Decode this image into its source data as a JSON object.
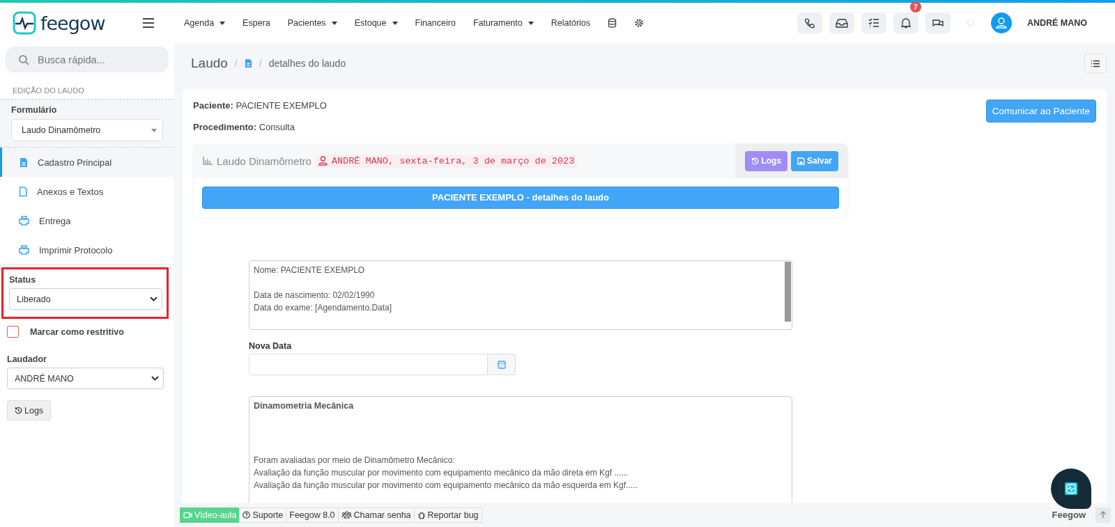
{
  "header": {
    "logo": "feegow",
    "nav": [
      {
        "label": "Agenda",
        "dropdown": true
      },
      {
        "label": "Espera",
        "dropdown": false
      },
      {
        "label": "Pacientes",
        "dropdown": true
      },
      {
        "label": "Estoque",
        "dropdown": true
      },
      {
        "label": "Financeiro",
        "dropdown": false
      },
      {
        "label": "Faturamento",
        "dropdown": true
      },
      {
        "label": "Relatórios",
        "dropdown": false
      }
    ],
    "tools": [
      {
        "kind": "phone"
      },
      {
        "kind": "inbox"
      },
      {
        "kind": "tasks"
      },
      {
        "kind": "bell",
        "badge": "7"
      },
      {
        "kind": "chat"
      }
    ],
    "user": "ANDRÉ MANO"
  },
  "sidebar": {
    "search": {
      "placeholder": "Busca rápida..."
    },
    "section": "EDIÇÃO DO LAUDO",
    "form_label": "Formulário",
    "form_value": "Laudo Dinamômetro",
    "items": [
      {
        "label": "Cadastro Principal",
        "kind": "doc",
        "selected": true
      },
      {
        "label": "Anexos e Textos",
        "kind": "file",
        "selected": false
      },
      {
        "label": "Entrega",
        "kind": "print",
        "selected": false
      },
      {
        "label": "Imprimir Protocolo",
        "kind": "print",
        "selected": false
      }
    ],
    "status": {
      "label": "Status",
      "value": "Liberado",
      "highlighted": true
    },
    "restrict": {
      "label": "Marcar como restritivo",
      "checked": false
    },
    "laudador": {
      "label": "Laudador",
      "value": "ANDRÉ MANO"
    },
    "logs_button": "Logs"
  },
  "breadcrumb": {
    "root": "Laudo",
    "separator": "/",
    "current": "detalhes do laudo"
  },
  "card": {
    "patient_label": "Paciente:",
    "patient": "PACIENTE EXEMPLO",
    "procedure_label": "Procedimento:",
    "procedure": "Consulta",
    "action": "Comunicar ao Paciente",
    "panel": {
      "title": "Laudo Dinamômetro",
      "author": "ANDRÉ MANO, sexta-feira, 3 de março de 2023",
      "buttons": [
        {
          "label": "Logs",
          "kind": "logs"
        },
        {
          "label": "Salvar",
          "kind": "save"
        }
      ],
      "banner": "PACIENTE EXEMPLO - detalhes do laudo"
    },
    "textarea1": [
      [
        "Nome: PACIENTE EXEMPLO"
      ],
      [
        "Data de nascimento: 02/02/1990",
        "Data do exame: [Agendamento.Data]"
      ]
    ],
    "date_label": "Nova Data",
    "textarea2": {
      "title": "Dinamometria Mecânica",
      "lines": [
        "Foram avaliadas por meio de Dinamômetro Mecânico:",
        "Avaliação da função muscular por movimento com equipamento mecânico da mão direta em Kgf ......",
        "Avaliação da função muscular por movimento com equipamento mecânico da mão esquerda em Kgf....."
      ]
    }
  },
  "footer": {
    "items": [
      {
        "label": "Vídeo-aula",
        "kind": "video"
      },
      {
        "label": "Suporte",
        "kind": "help"
      },
      {
        "label": "Feegow 8.0",
        "kind": "version"
      },
      {
        "label": "Chamar senha",
        "kind": "users"
      },
      {
        "label": "Reportar bug",
        "kind": "bug"
      }
    ],
    "brand": "Feegow"
  }
}
